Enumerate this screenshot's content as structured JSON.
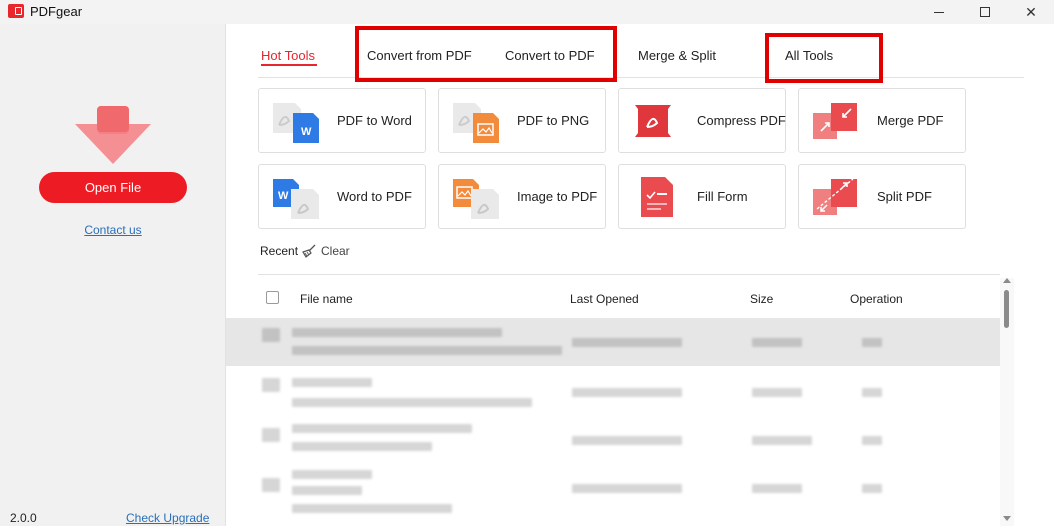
{
  "app": {
    "title": "PDFgear",
    "version": "2.0.0"
  },
  "window_controls": {
    "minimize": "minimize-icon",
    "maximize": "maximize-icon",
    "close": "✕"
  },
  "sidebar": {
    "open_file": "Open File",
    "contact": "Contact us",
    "check_upgrade": "Check Upgrade"
  },
  "tabs": [
    {
      "label": "Hot Tools",
      "active": true
    },
    {
      "label": "Convert from PDF",
      "active": false
    },
    {
      "label": "Convert to PDF",
      "active": false
    },
    {
      "label": "Merge & Split",
      "active": false
    },
    {
      "label": "All Tools",
      "active": false
    }
  ],
  "tools": [
    {
      "label": "PDF to Word",
      "icon": "pdf-to-word-icon"
    },
    {
      "label": "PDF to PNG",
      "icon": "pdf-to-png-icon"
    },
    {
      "label": "Compress PDF",
      "icon": "compress-pdf-icon"
    },
    {
      "label": "Merge PDF",
      "icon": "merge-pdf-icon"
    },
    {
      "label": "Word to PDF",
      "icon": "word-to-pdf-icon"
    },
    {
      "label": "Image to PDF",
      "icon": "image-to-pdf-icon"
    },
    {
      "label": "Fill Form",
      "icon": "fill-form-icon"
    },
    {
      "label": "Split PDF",
      "icon": "split-pdf-icon"
    }
  ],
  "recent": {
    "label": "Recent",
    "clear": "Clear",
    "columns": [
      "File name",
      "Last Opened",
      "Size",
      "Operation"
    ]
  },
  "colors": {
    "accent": "#e8262d",
    "highlight": "#e00000",
    "link": "#2a6fb8"
  }
}
